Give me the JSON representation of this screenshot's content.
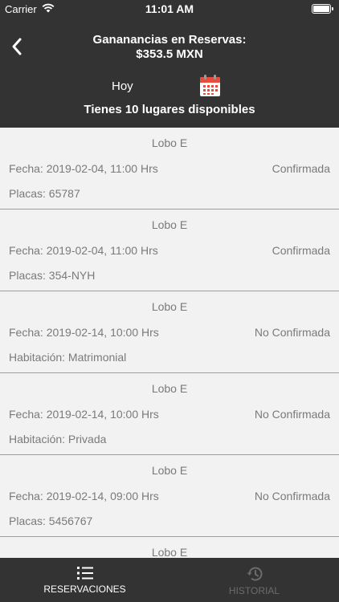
{
  "status_bar": {
    "carrier": "Carrier",
    "time": "11:01 AM",
    "wifi_icon": "wifi-icon",
    "battery_icon": "battery-icon"
  },
  "header": {
    "back_icon": "chevron-left-icon",
    "title_line1": "Gananancias en Reservas:",
    "title_line2": "$353.5 MXN",
    "today_label": "Hoy",
    "calendar_icon": "calendar-icon",
    "availability": "Tienes 10 lugares disponibles"
  },
  "reservations": [
    {
      "name": "Lobo E",
      "date": "Fecha: 2019-02-04, 11:00 Hrs",
      "status": "Confirmada",
      "detail": "Placas: 65787"
    },
    {
      "name": "Lobo E",
      "date": "Fecha: 2019-02-04, 11:00 Hrs",
      "status": "Confirmada",
      "detail": "Placas: 354-NYH"
    },
    {
      "name": "Lobo E",
      "date": "Fecha: 2019-02-14, 10:00 Hrs",
      "status": "No Confirmada",
      "detail": "Habitación: Matrimonial"
    },
    {
      "name": "Lobo E",
      "date": "Fecha: 2019-02-14, 10:00 Hrs",
      "status": "No Confirmada",
      "detail": "Habitación: Privada"
    },
    {
      "name": "Lobo E",
      "date": "Fecha: 2019-02-14, 09:00 Hrs",
      "status": "No Confirmada",
      "detail": "Placas: 5456767"
    },
    {
      "name": "Lobo E",
      "date": "",
      "status": "",
      "detail": ""
    }
  ],
  "tabs": [
    {
      "label": "RESERVACIONES",
      "icon": "list-icon",
      "active": true
    },
    {
      "label": "HISTORIAL",
      "icon": "history-icon",
      "active": false
    }
  ],
  "colors": {
    "dark_bar": "#333333",
    "list_background": "#f2f2f2",
    "secondary_text": "#7a7a7a",
    "calendar_red": "#e74c3c"
  }
}
